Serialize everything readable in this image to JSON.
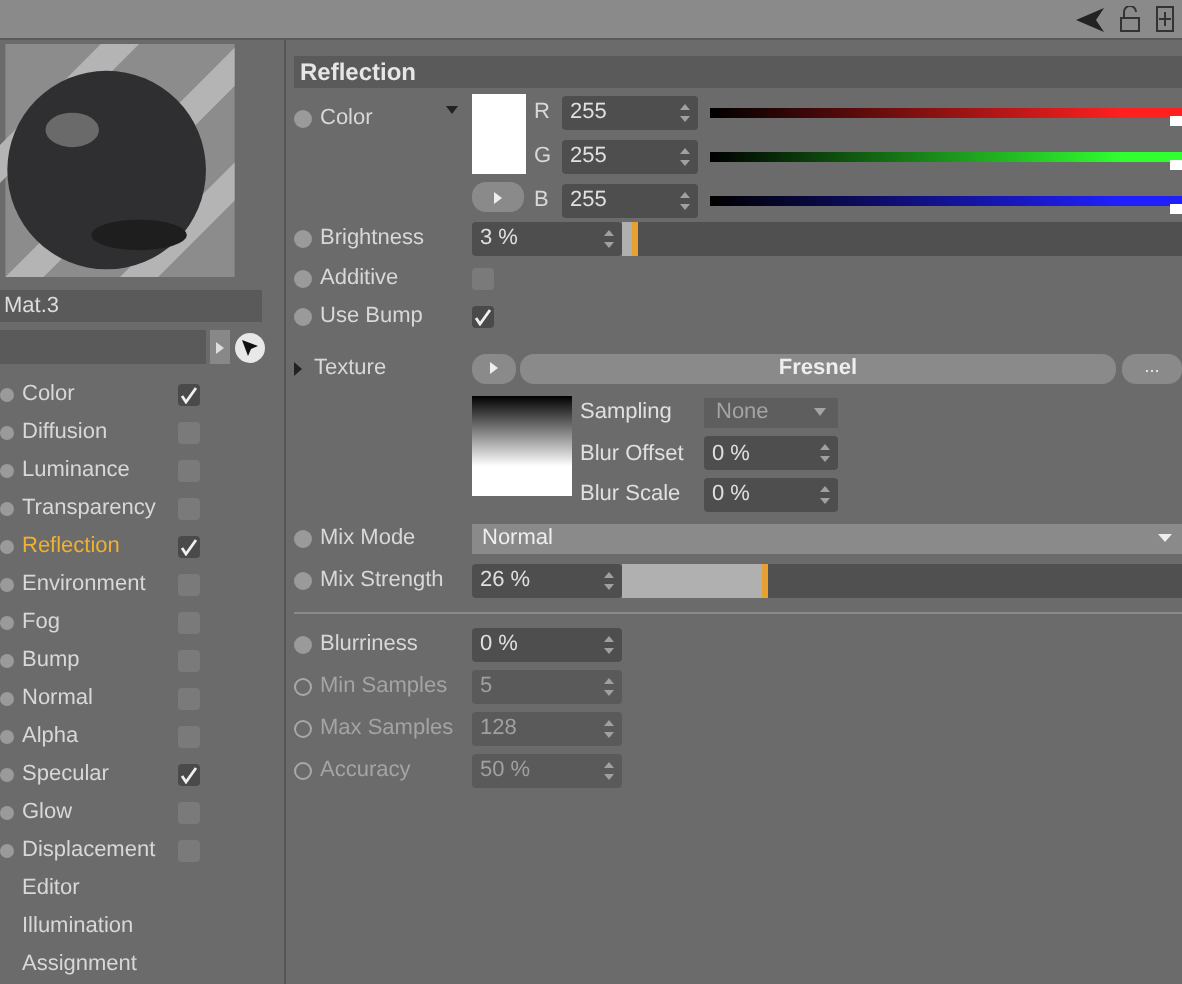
{
  "material": {
    "name": "Mat.3"
  },
  "channels": [
    {
      "kind": "channel",
      "label": "Color",
      "checked": true,
      "selected": false
    },
    {
      "kind": "channel",
      "label": "Diffusion",
      "checked": false,
      "selected": false
    },
    {
      "kind": "channel",
      "label": "Luminance",
      "checked": false,
      "selected": false
    },
    {
      "kind": "channel",
      "label": "Transparency",
      "checked": false,
      "selected": false
    },
    {
      "kind": "channel",
      "label": "Reflection",
      "checked": true,
      "selected": true
    },
    {
      "kind": "channel",
      "label": "Environment",
      "checked": false,
      "selected": false
    },
    {
      "kind": "channel",
      "label": "Fog",
      "checked": false,
      "selected": false
    },
    {
      "kind": "channel",
      "label": "Bump",
      "checked": false,
      "selected": false
    },
    {
      "kind": "channel",
      "label": "Normal",
      "checked": false,
      "selected": false
    },
    {
      "kind": "channel",
      "label": "Alpha",
      "checked": false,
      "selected": false
    },
    {
      "kind": "channel",
      "label": "Specular",
      "checked": true,
      "selected": false
    },
    {
      "kind": "channel",
      "label": "Glow",
      "checked": false,
      "selected": false
    },
    {
      "kind": "channel",
      "label": "Displacement",
      "checked": false,
      "selected": false
    },
    {
      "kind": "page",
      "label": "Editor",
      "selected": false
    },
    {
      "kind": "page",
      "label": "Illumination",
      "selected": false
    },
    {
      "kind": "page",
      "label": "Assignment",
      "selected": false
    }
  ],
  "section": {
    "title": "Reflection"
  },
  "color": {
    "label": "Color",
    "channels": [
      {
        "name": "R",
        "value": "255",
        "level": 1,
        "color": "#ff2020"
      },
      {
        "name": "G",
        "value": "255",
        "level": 1,
        "color": "#30ff30"
      },
      {
        "name": "B",
        "value": "255",
        "level": 1,
        "color": "#2020ff"
      }
    ]
  },
  "brightness": {
    "label": "Brightness",
    "value": "3 %",
    "level": 0.03
  },
  "additive": {
    "label": "Additive",
    "checked": false
  },
  "use_bump": {
    "label": "Use Bump",
    "checked": true
  },
  "texture": {
    "label": "Texture",
    "shader": "Fresnel",
    "more": "...",
    "params": [
      {
        "kind": "select",
        "label": "Sampling",
        "value": "None",
        "disabled": true
      },
      {
        "kind": "number",
        "label": "Blur Offset",
        "value": "0 %",
        "disabled": false
      },
      {
        "kind": "number",
        "label": "Blur Scale",
        "value": "0 %",
        "disabled": false
      }
    ]
  },
  "mix_mode": {
    "label": "Mix Mode",
    "value": "Normal"
  },
  "mix_strength": {
    "label": "Mix Strength",
    "value": "26 %",
    "level": 0.26
  },
  "sampling": [
    {
      "label": "Blurriness",
      "value": "0 %",
      "disabled": false
    },
    {
      "label": "Min Samples",
      "value": "5",
      "disabled": true
    },
    {
      "label": "Max Samples",
      "value": "128",
      "disabled": true
    },
    {
      "label": "Accuracy",
      "value": "50 %",
      "disabled": true
    }
  ]
}
